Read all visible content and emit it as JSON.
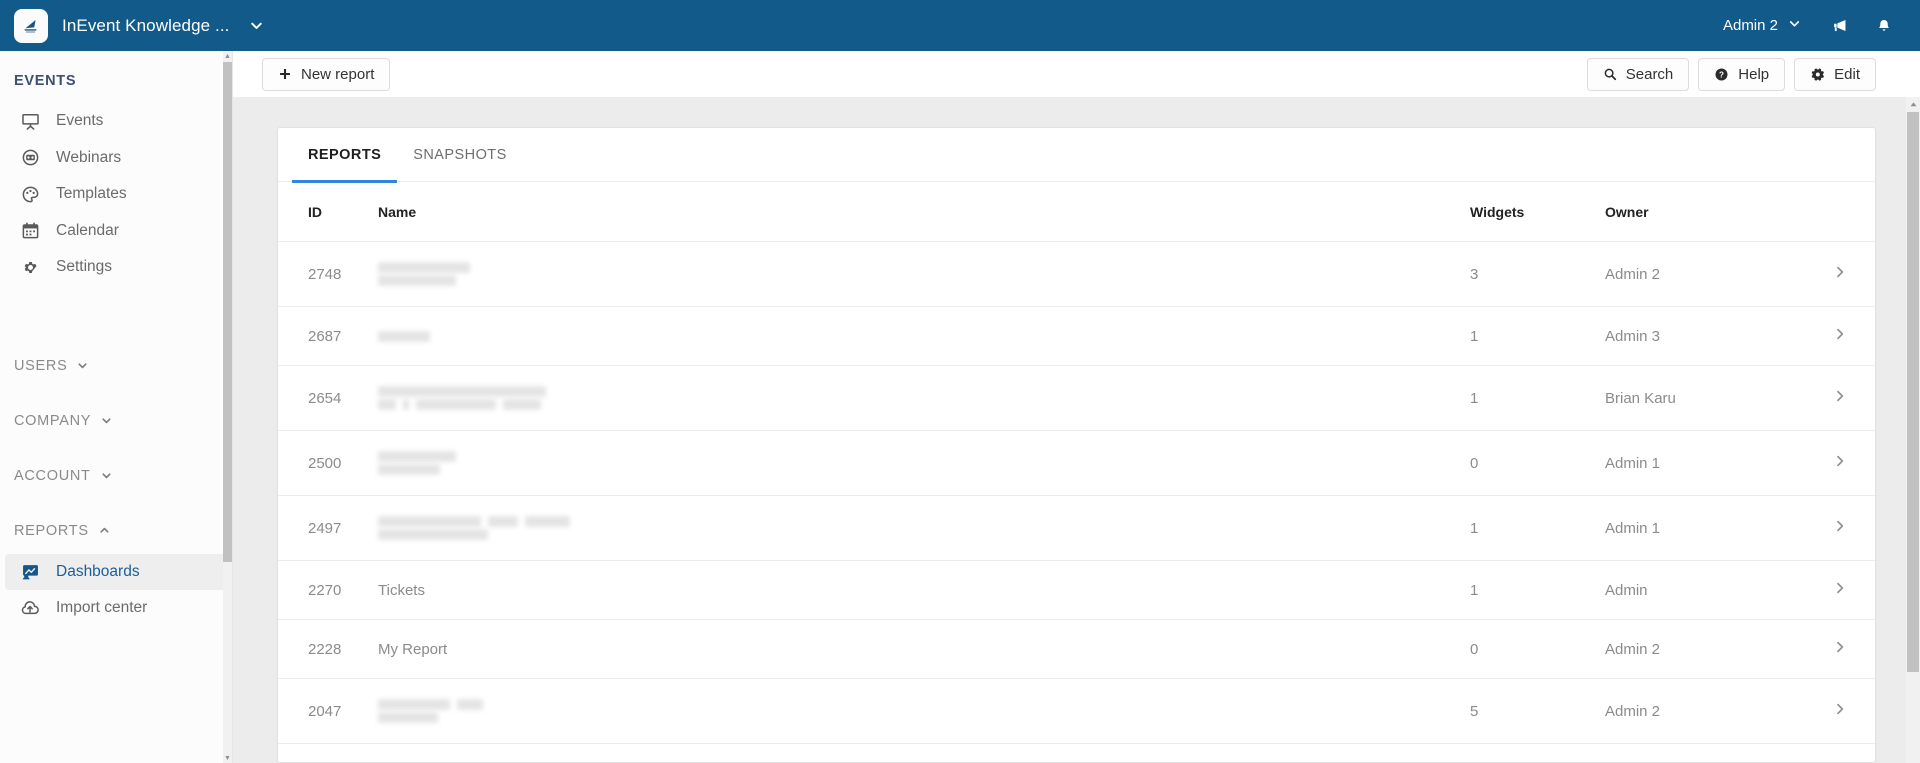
{
  "topbar": {
    "brand_title": "InEvent Knowledge ...",
    "brand_caret_icon": "chevron-down-icon",
    "logo_icon": "inevent-logo-icon",
    "user_name": "Admin 2",
    "user_caret_icon": "chevron-down-icon",
    "announcements_icon": "megaphone-icon",
    "notifications_icon": "bell-icon",
    "bg_color": "#115a8a"
  },
  "sidebar": {
    "section_title": "EVENTS",
    "items": [
      {
        "label": "Events",
        "icon": "presentation-screen-icon",
        "active": false
      },
      {
        "label": "Webinars",
        "icon": "webinar-icon",
        "active": false
      },
      {
        "label": "Templates",
        "icon": "palette-icon",
        "active": false
      },
      {
        "label": "Calendar",
        "icon": "calendar-icon",
        "active": false
      },
      {
        "label": "Settings",
        "icon": "gear-icon",
        "active": false
      }
    ],
    "groups": [
      {
        "label": "USERS",
        "caret": "chevron-down-icon",
        "expanded": false
      },
      {
        "label": "COMPANY",
        "caret": "chevron-down-icon",
        "expanded": false
      },
      {
        "label": "ACCOUNT",
        "caret": "chevron-down-icon",
        "expanded": false
      },
      {
        "label": "REPORTS",
        "caret": "chevron-up-icon",
        "expanded": true
      }
    ],
    "reports_items": [
      {
        "label": "Dashboards",
        "icon": "dashboard-icon",
        "active": true
      },
      {
        "label": "Import center",
        "icon": "cloud-upload-icon",
        "active": false
      }
    ],
    "active_color": "#1b5e96"
  },
  "toolbar": {
    "new_report_label": "New report",
    "new_report_icon": "plus-icon",
    "search_label": "Search",
    "search_icon": "search-icon",
    "help_label": "Help",
    "help_icon": "question-circle-icon",
    "edit_label": "Edit",
    "edit_icon": "gear-icon"
  },
  "tabs": [
    {
      "label": "REPORTS",
      "active": true
    },
    {
      "label": "SNAPSHOTS",
      "active": false
    }
  ],
  "table": {
    "headers": [
      "ID",
      "Name",
      "Widgets",
      "Owner"
    ],
    "accent_color": "#2e86de",
    "rows": [
      {
        "id": "2748",
        "name": "",
        "name_redacted": true,
        "redact_lines": [
          [
            92
          ],
          [
            78
          ]
        ],
        "widgets": "3",
        "owner": "Admin 2",
        "arrow_icon": "chevron-right-icon"
      },
      {
        "id": "2687",
        "name": "",
        "name_redacted": true,
        "redact_lines": [
          [
            52
          ]
        ],
        "widgets": "1",
        "owner": "Admin 3",
        "arrow_icon": "chevron-right-icon"
      },
      {
        "id": "2654",
        "name": "",
        "name_redacted": true,
        "redact_lines": [
          [
            168
          ],
          [
            18,
            6,
            80,
            38
          ]
        ],
        "widgets": "1",
        "owner": "Brian Karu",
        "arrow_icon": "chevron-right-icon"
      },
      {
        "id": "2500",
        "name": "",
        "name_redacted": true,
        "redact_lines": [
          [
            78
          ],
          [
            62
          ]
        ],
        "widgets": "0",
        "owner": "Admin 1",
        "arrow_icon": "chevron-right-icon"
      },
      {
        "id": "2497",
        "name": "",
        "name_redacted": true,
        "redact_lines": [
          [
            103,
            30,
            45
          ],
          [
            110
          ]
        ],
        "widgets": "1",
        "owner": "Admin 1",
        "arrow_icon": "chevron-right-icon"
      },
      {
        "id": "2270",
        "name": "Tickets",
        "name_redacted": false,
        "redact_lines": [],
        "widgets": "1",
        "owner": "Admin",
        "arrow_icon": "chevron-right-icon"
      },
      {
        "id": "2228",
        "name": "My Report",
        "name_redacted": false,
        "redact_lines": [],
        "widgets": "0",
        "owner": "Admin 2",
        "arrow_icon": "chevron-right-icon"
      },
      {
        "id": "2047",
        "name": "",
        "name_redacted": true,
        "redact_lines": [
          [
            72,
            26
          ],
          [
            60
          ]
        ],
        "widgets": "5",
        "owner": "Admin 2",
        "arrow_icon": "chevron-right-icon"
      }
    ]
  },
  "scrollbars": {
    "sidebar_up_icon": "triangle-up-icon",
    "sidebar_down_icon": "triangle-down-icon",
    "page_up_icon": "triangle-up-icon"
  }
}
